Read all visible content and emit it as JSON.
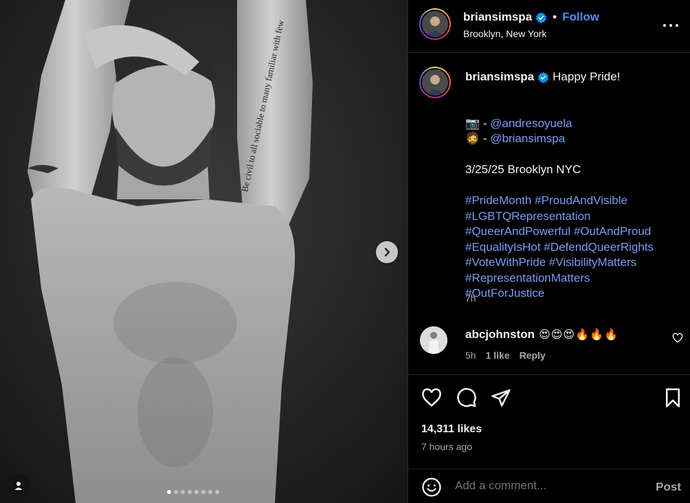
{
  "header": {
    "username": "briansimspa",
    "separator": "•",
    "follow_label": "Follow",
    "location": "Brooklyn, New York"
  },
  "caption": {
    "username": "briansimspa",
    "lines": [
      {
        "text": "Happy Pride!",
        "kind": "text"
      },
      {
        "text": "",
        "kind": "blank"
      },
      {
        "prefix": "📷 - ",
        "text": "@andresoyuela",
        "kind": "link"
      },
      {
        "prefix": "🧔 - ",
        "text": "@briansimspa",
        "kind": "link"
      },
      {
        "text": "",
        "kind": "blank"
      },
      {
        "text": "3/25/25 Brooklyn NYC",
        "kind": "text"
      },
      {
        "text": "",
        "kind": "blank"
      },
      {
        "text": "#PrideMonth #ProudAndVisible",
        "kind": "hash"
      },
      {
        "text": "#LGBTQRepresentation",
        "kind": "hash"
      },
      {
        "text": "#QueerAndPowerful #OutAndProud",
        "kind": "hash"
      },
      {
        "text": "#EqualityIsHot #DefendQueerRights",
        "kind": "hash"
      },
      {
        "text": "#VoteWithPride #VisibilityMatters",
        "kind": "hash"
      },
      {
        "text": "#RepresentationMatters",
        "kind": "hash"
      },
      {
        "text": "#OutForJustice",
        "kind": "hash"
      }
    ],
    "time": "7h"
  },
  "comment": {
    "username": "abcjohnston",
    "text": "😍😍😍🔥🔥🔥",
    "time": "5h",
    "likes": "1 like",
    "reply_label": "Reply"
  },
  "actions": {
    "likes_count": "14,311 likes",
    "posted_ago": "7 hours ago"
  },
  "comment_box": {
    "placeholder": "Add a comment...",
    "post_label": "Post"
  },
  "carousel": {
    "total_slides": 8,
    "active_slide": 1
  },
  "colors": {
    "accent_link": "#4c8df6",
    "hashtag": "#7a9cf5",
    "muted": "#a8a8a8",
    "divider": "#262626"
  }
}
